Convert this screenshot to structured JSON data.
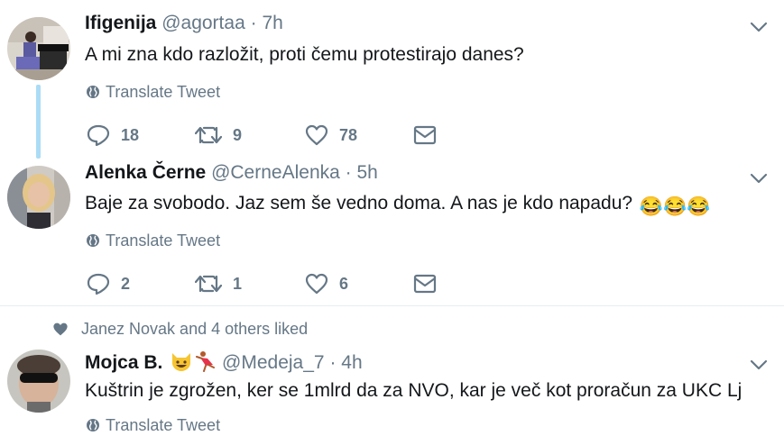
{
  "tweets": [
    {
      "name": "Ifigenija",
      "handle": "@agortaa",
      "separator": "·",
      "time": "7h",
      "text": "A mi zna kdo razložit, proti čemu protestirajo danes?",
      "translate": "Translate Tweet",
      "replies": "18",
      "retweets": "9",
      "likes": "78"
    },
    {
      "name": "Alenka Černe",
      "handle": "@CerneAlenka",
      "separator": "·",
      "time": "5h",
      "text": "Baje za svobodo. Jaz sem še vedno doma. A nas je kdo napadu?",
      "emoji": "😂😂😂",
      "translate": "Translate Tweet",
      "replies": "2",
      "retweets": "1",
      "likes": "6"
    },
    {
      "liked_by": "Janez Novak and 4 others liked",
      "name": "Mojca B.",
      "handle": "@Medeja_7",
      "separator": "·",
      "time": "4h",
      "text": "Kuštrin je zgrožen, ker se 1mlrd da za NVO,  kar je več kot proračun za UKC Lj",
      "translate": "Translate Tweet"
    }
  ],
  "icons": {
    "reply": "reply-icon",
    "retweet": "retweet-icon",
    "like": "heart-icon",
    "message": "envelope-icon",
    "caret": "chevron-down-icon",
    "translate": "globe-icon"
  },
  "colors": {
    "text": "#14171a",
    "muted": "#657786",
    "thread": "#abdcf5",
    "divider": "#e6ecf0"
  }
}
